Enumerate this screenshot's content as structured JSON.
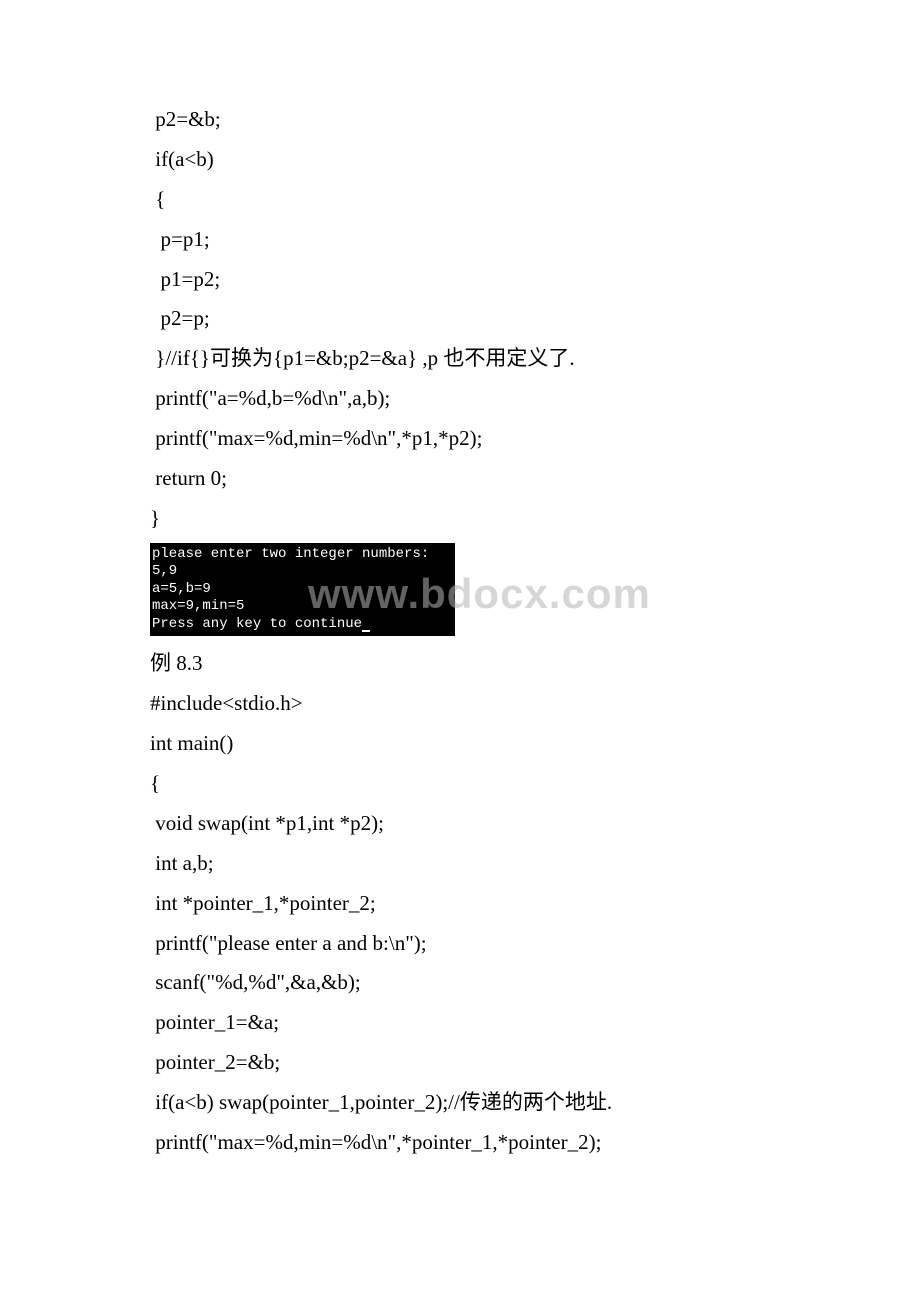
{
  "lines": {
    "l1": " p2=&b;",
    "l2": " if(a<b)",
    "l3": " {",
    "l4": "  p=p1;",
    "l5": "  p1=p2;",
    "l6": "  p2=p;",
    "l7": " }//if{}可换为{p1=&b;p2=&a} ,p 也不用定义了.",
    "l8": " printf(\"a=%d,b=%d\\n\",a,b);",
    "l9": " printf(\"max=%d,min=%d\\n\",*p1,*p2);",
    "l10": " return 0;",
    "l11": "}"
  },
  "console": {
    "c1": "please enter two integer numbers:",
    "c2": "5,9",
    "c3": "a=5,b=9",
    "c4": "max=9,min=5",
    "c5": "Press any key to continue"
  },
  "watermark": "www.bdocx.com",
  "section2": {
    "title": "例 8.3",
    "s1": "#include<stdio.h>",
    "s2": "int main()",
    "s3": "{",
    "s4": " void swap(int *p1,int *p2);",
    "s5": " int a,b;",
    "s6": " int *pointer_1,*pointer_2;",
    "s7": " printf(\"please enter a and b:\\n\");",
    "s8": " scanf(\"%d,%d\",&a,&b);",
    "s9": " pointer_1=&a;",
    "s10": " pointer_2=&b;",
    "s11": " if(a<b) swap(pointer_1,pointer_2);//传递的两个地址.",
    "s12": " printf(\"max=%d,min=%d\\n\",*pointer_1,*pointer_2);"
  }
}
